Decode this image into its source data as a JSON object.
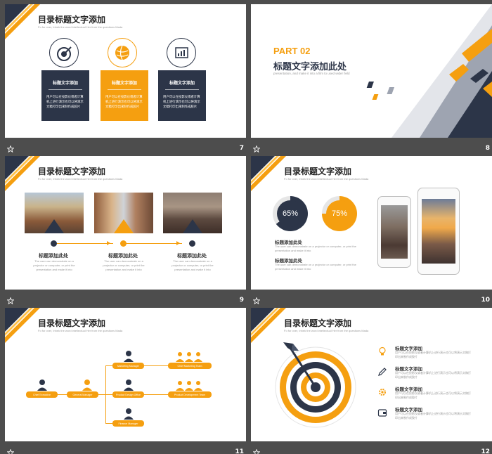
{
  "colors": {
    "orange": "#f59f10",
    "navy": "#2c3548",
    "background": "#4d4d4d"
  },
  "slides": [
    {
      "num": "7",
      "title": "目录标题文字添加",
      "subtitle": "Fo for over, Inhek the word intellectual Her from the questions Mada",
      "icons": [
        "target-icon",
        "globe-icon",
        "chart-icon"
      ],
      "cards": [
        {
          "title": "标题文字添加",
          "body": "用户可以在投影仪或者计算机上进行演示也可以将演示文稿打印出来制作成胶片"
        },
        {
          "title": "标题文字添加",
          "body": "用户可以在投影仪或者计算机上进行演示也可以将演示文稿打印出来制作成胶片"
        },
        {
          "title": "标题文字添加",
          "body": "用户可以在投影仪或者计算机上进行演示也可以将演示文稿打印出来制作成胶片"
        }
      ]
    },
    {
      "num": "8",
      "part": "PART 02",
      "title": "标题文字添加此处",
      "subtitle": "presentation, and make it into a film to used wider field"
    },
    {
      "num": "9",
      "title": "目录标题文字添加",
      "subtitle": "Fo for over, Inhek the word intellectual Her from the questions Mada",
      "items": [
        {
          "title": "标题添加此处",
          "body": "The user can demonstrate on a projector or computer, or print the presentation and make it into"
        },
        {
          "title": "标题添加此处",
          "body": "The user can demonstrate on a projector or computer, or print the presentation and make it into"
        },
        {
          "title": "标题添加此处",
          "body": "The user can demonstrate on a projector or computer, or print the presentation and make it into"
        }
      ]
    },
    {
      "num": "10",
      "title": "目录标题文字添加",
      "subtitle": "Fo for over, Inhek the word intellectual Her from the questions Mada",
      "rings": [
        {
          "label": "65%",
          "value": 65
        },
        {
          "label": "75%",
          "value": 75
        }
      ],
      "blocks": [
        {
          "title": "标题添加此处",
          "body": "The user can demonstrate on a projector or computer, or print the presentation and make it into"
        },
        {
          "title": "标题添加此处",
          "body": "The user can demonstrate on a projector or computer, or print the presentation and make it into"
        }
      ]
    },
    {
      "num": "11",
      "title": "目录标题文字添加",
      "subtitle": "Fo for over, Inhek the word intellectual Her from the questions Mada",
      "org": {
        "root": "Chief Executive",
        "level2": "General Manager",
        "level3": [
          "Marketing Manager",
          "Product Design Office",
          "Finance Manager"
        ],
        "level4": [
          "Chief Marketing Team",
          "Product Development Team"
        ]
      }
    },
    {
      "num": "12",
      "title": "目录标题文字添加",
      "subtitle": "Fo for over, Inhek the word intellectual Her from the questions Mada",
      "features": [
        {
          "icon": "bulb-icon",
          "title": "标题文字添加",
          "body": "用户可以在投影仪或者计算机上进行演示也可以将演示文稿打印出来制作成胶片"
        },
        {
          "icon": "pen-icon",
          "title": "标题文字添加",
          "body": "用户可以在投影仪或者计算机上进行演示也可以将演示文稿打印出来制作成胶片"
        },
        {
          "icon": "gear-icon",
          "title": "标题文字添加",
          "body": "用户可以在投影仪或者计算机上进行演示也可以将演示文稿打印出来制作成胶片"
        },
        {
          "icon": "wallet-icon",
          "title": "标题文字添加",
          "body": "用户可以在投影仪或者计算机上进行演示也可以将演示文稿打印出来制作成胶片"
        }
      ]
    }
  ]
}
